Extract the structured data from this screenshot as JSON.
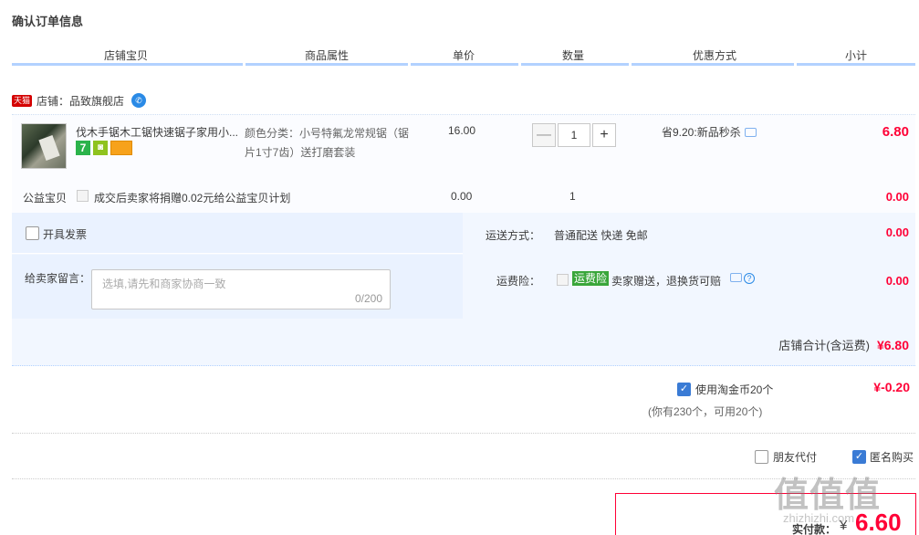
{
  "page_title": "确认订单信息",
  "columns": [
    "店铺宝贝",
    "商品属性",
    "单价",
    "数量",
    "优惠方式",
    "小计"
  ],
  "shop": {
    "badge": "天猫",
    "label": "店铺：品致旗舰店"
  },
  "item": {
    "name": "伐木手锯木工锯快速锯子家用小...",
    "badge_7": "7",
    "attributes": "颜色分类：小号特氟龙常规锯（锯片1寸7齿）送打磨套装",
    "unit_price": "16.00",
    "quantity": "1",
    "minus": "—",
    "plus": "+",
    "promo": "省9.20:新品秒杀",
    "subtotal": "6.80"
  },
  "charity": {
    "label": "公益宝贝",
    "desc": "成交后卖家将捐赠0.02元给公益宝贝计划",
    "price": "0.00",
    "qty": "1",
    "subtotal": "0.00"
  },
  "invoice": {
    "label": "开具发票"
  },
  "shipping": {
    "label": "运送方式：",
    "value": "普通配送 快递 免邮",
    "amount": "0.00"
  },
  "message": {
    "label": "给卖家留言：",
    "placeholder": "选填,请先和商家协商一致",
    "counter": "0/200"
  },
  "insurance": {
    "label": "运费险：",
    "badge": "运费险",
    "text": "卖家赠送，退换货可赔",
    "amount": "0.00"
  },
  "shop_total": {
    "label": "店铺合计(含运费)",
    "amount": "¥6.80"
  },
  "coins": {
    "label": "使用淘金币20个",
    "sub": "(你有230个，可用20个)",
    "amount": "¥-0.20"
  },
  "friend_pay": {
    "label": "朋友代付"
  },
  "anonymous": {
    "label": "匿名购买"
  },
  "payment": {
    "label": "实付款：",
    "yen": "¥",
    "amount": "6.60"
  },
  "watermark": {
    "main": "值值值",
    "sub": "zhizhizhi.com"
  }
}
